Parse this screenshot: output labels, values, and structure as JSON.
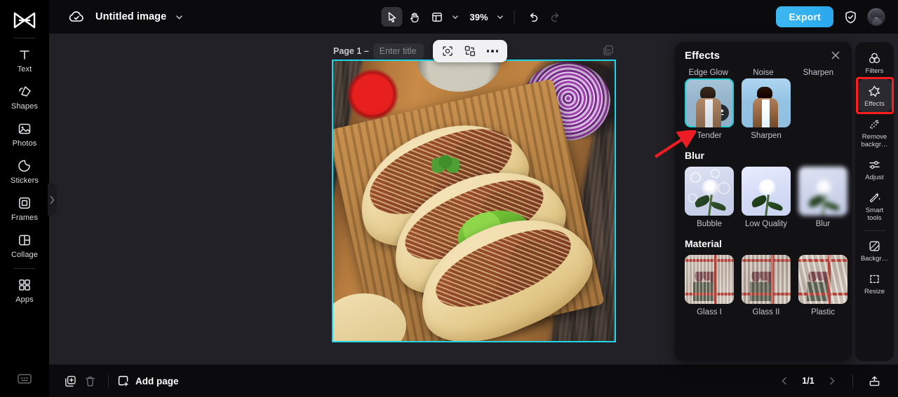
{
  "app": {
    "brand_icon": "capcut-logo-icon",
    "doc_title": "Untitled image",
    "cloud_icon": "cloud-saved-icon",
    "title_caret_icon": "chevron-down-icon"
  },
  "sidebar": {
    "items": [
      {
        "icon": "text-icon",
        "label": "Text"
      },
      {
        "icon": "shapes-icon",
        "label": "Shapes"
      },
      {
        "icon": "photos-icon",
        "label": "Photos"
      },
      {
        "icon": "stickers-icon",
        "label": "Stickers"
      },
      {
        "icon": "frames-icon",
        "label": "Frames"
      },
      {
        "icon": "collage-icon",
        "label": "Collage"
      },
      {
        "icon": "apps-icon",
        "label": "Apps"
      }
    ],
    "keyboard_icon": "keyboard-shortcuts-icon",
    "collapse_icon": "chevron-right-icon"
  },
  "toolbar": {
    "select_tool_icon": "cursor-arrow-icon",
    "hand_tool_icon": "hand-pan-icon",
    "layout_icon": "layout-grid-icon",
    "layout_caret_icon": "chevron-down-icon",
    "zoom_level": "39%",
    "zoom_caret_icon": "chevron-down-icon",
    "undo_icon": "undo-icon",
    "redo_icon": "redo-icon",
    "export_label": "Export",
    "shield_icon": "shield-check-icon",
    "avatar_icon": "user-avatar"
  },
  "canvas": {
    "page_label": "Page 1 –",
    "title_placeholder": "Enter title",
    "title_value": "",
    "layers_icon": "layers-stack-icon",
    "float_toolbar": {
      "cutout_icon": "cutout-select-icon",
      "replace_icon": "replace-image-icon",
      "more_icon": "more-options-icon"
    },
    "image_alt": "tacos-on-wooden-board-photo",
    "selection_color": "#1fd6e8"
  },
  "effects_panel": {
    "title": "Effects",
    "close_icon": "close-icon",
    "cut_off_labels": [
      "Edge Glow",
      "Noise",
      "Sharpen"
    ],
    "groups": [
      {
        "heading": "",
        "items": [
          {
            "label": "Tender",
            "selected": true,
            "badge_icon": "adjust-sliders-icon"
          },
          {
            "label": "Sharpen",
            "selected": false,
            "badge_icon": ""
          }
        ]
      },
      {
        "heading": "Blur",
        "items": [
          {
            "label": "Bubble",
            "selected": false,
            "badge_icon": ""
          },
          {
            "label": "Low Quality",
            "selected": false,
            "badge_icon": ""
          },
          {
            "label": "Blur",
            "selected": false,
            "badge_icon": ""
          }
        ]
      },
      {
        "heading": "Material",
        "items": [
          {
            "label": "Glass I",
            "selected": false,
            "badge_icon": ""
          },
          {
            "label": "Glass II",
            "selected": false,
            "badge_icon": ""
          },
          {
            "label": "Plastic",
            "selected": false,
            "badge_icon": ""
          }
        ]
      }
    ],
    "selected_border_color": "#24ccd4"
  },
  "right_rail": {
    "items": [
      {
        "icon": "filters-icon",
        "label": "Filters",
        "active": false,
        "highlighted": false
      },
      {
        "icon": "effects-star-icon",
        "label": "Effects",
        "active": true,
        "highlighted": true
      },
      {
        "icon": "remove-bg-icon",
        "label": "Remove\nbackgr…",
        "active": false,
        "highlighted": false
      },
      {
        "icon": "adjust-sliders-icon",
        "label": "Adjust",
        "active": false,
        "highlighted": false
      },
      {
        "icon": "smart-tools-icon",
        "label": "Smart\ntools",
        "active": false,
        "highlighted": false
      },
      {
        "icon": "background-icon",
        "label": "Backgr…",
        "active": false,
        "highlighted": false
      },
      {
        "icon": "resize-icon",
        "label": "Resize",
        "active": false,
        "highlighted": false
      }
    ],
    "highlight_color": "#ff1d1d"
  },
  "annotation": {
    "arrow_icon": "red-pointer-arrow",
    "arrow_color": "#ec1c24"
  },
  "bottombar": {
    "duplicate_icon": "duplicate-page-icon",
    "delete_icon": "trash-icon",
    "add_page_icon": "add-page-icon",
    "add_page_label": "Add page",
    "prev_icon": "chevron-left-icon",
    "page_counter": "1/1",
    "next_icon": "chevron-right-icon",
    "upload_icon": "export-upload-icon"
  }
}
